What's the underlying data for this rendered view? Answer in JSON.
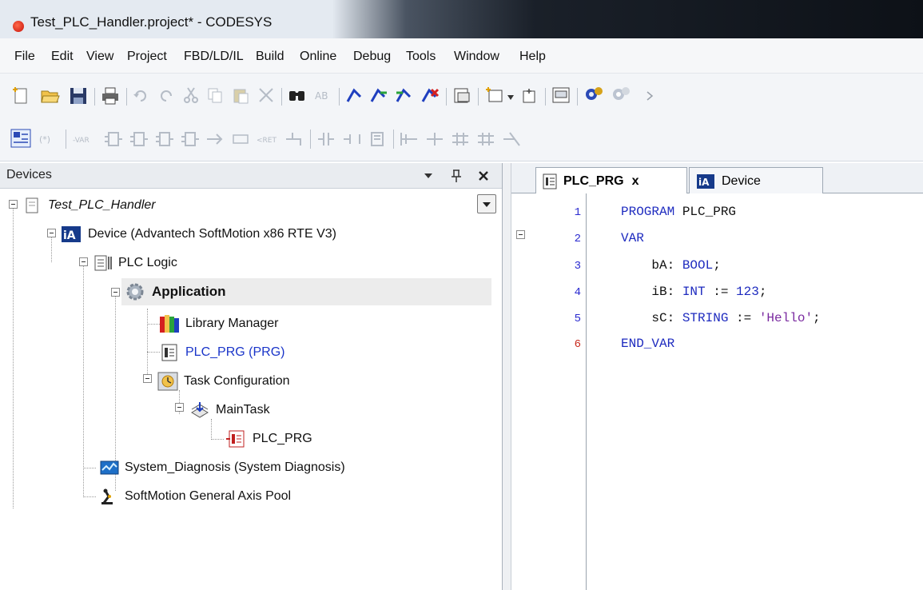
{
  "window": {
    "title": "Test_PLC_Handler.project* - CODESYS"
  },
  "menu": [
    "File",
    "Edit",
    "View",
    "Project",
    "FBD/LD/IL",
    "Build",
    "Online",
    "Debug",
    "Tools",
    "Window",
    "Help"
  ],
  "devices_panel": {
    "title": "Devices",
    "pin_symbol": "↓",
    "dock_symbol": "❑",
    "close_symbol": "✕",
    "tree": [
      {
        "id": "project",
        "label": "Test_PLC_Handler",
        "icon": "project-icon"
      },
      {
        "id": "device",
        "label": "Device (Advantech SoftMotion x86 RTE V3)",
        "icon": "device-icon"
      },
      {
        "id": "plc-logic",
        "label": "PLC Logic",
        "icon": "plc-logic-icon"
      },
      {
        "id": "application",
        "label": "Application",
        "icon": "application-gear-icon"
      },
      {
        "id": "library-manager",
        "label": "Library Manager",
        "icon": "library-icon"
      },
      {
        "id": "plc-prg",
        "label": "PLC_PRG (PRG)",
        "icon": "pou-icon"
      },
      {
        "id": "task-config",
        "label": "Task Configuration",
        "icon": "task-config-icon"
      },
      {
        "id": "maintask",
        "label": "MainTask",
        "icon": "task-icon"
      },
      {
        "id": "task-plc-prg",
        "label": "PLC_PRG",
        "icon": "pou-call-icon"
      },
      {
        "id": "system-diagnosis",
        "label": "System_Diagnosis (System Diagnosis)",
        "icon": "diagnosis-icon"
      },
      {
        "id": "axis-pool",
        "label": "SoftMotion General Axis Pool",
        "icon": "axis-pool-icon"
      }
    ]
  },
  "editor": {
    "tabs": [
      {
        "label": "PLC_PRG",
        "close": "x",
        "active": true
      },
      {
        "label": "Device",
        "active": false
      }
    ],
    "line_numbers": [
      "1",
      "2",
      "3",
      "4",
      "5",
      "6"
    ],
    "lines": {
      "l1_kw": "PROGRAM",
      "l1_rest": " PLC_PRG",
      "l2_kw": "VAR",
      "l3_name": "    bA: ",
      "l3_type": "BOOL",
      "l3_end": ";",
      "l4_name": "    iB: ",
      "l4_type": "INT",
      "l4_op": " := ",
      "l4_val": "123",
      "l4_end": ";",
      "l5_name": "    sC: ",
      "l5_type": "STRING",
      "l5_op": " := ",
      "l5_val": "'Hello'",
      "l5_end": ";",
      "l6_kw": "END_VAR"
    }
  },
  "colors": {
    "keyword": "#1e2bbf",
    "string": "#7a2aa0",
    "link": "#1a35c9",
    "error_line": "#c82a1e"
  }
}
